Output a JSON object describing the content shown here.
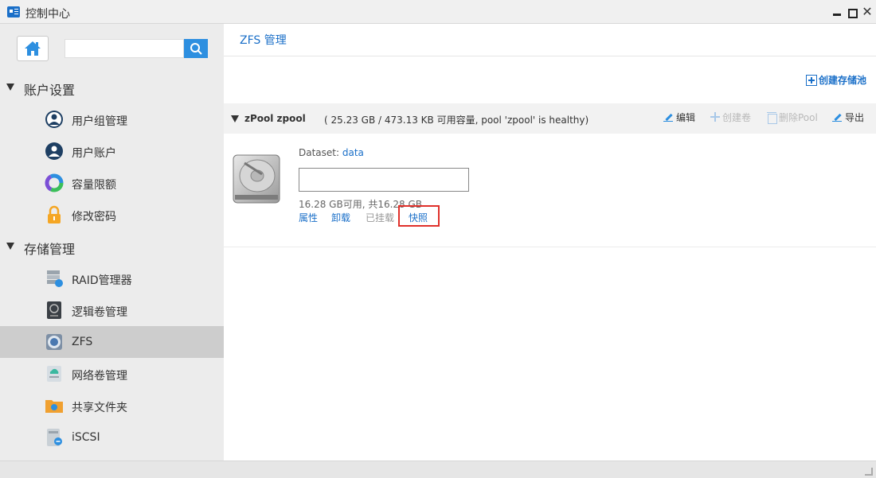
{
  "window": {
    "title": "控制中心",
    "close_glyph": "✕"
  },
  "sidebar": {
    "search": {
      "value": "",
      "placeholder": ""
    },
    "sections": [
      {
        "label": "账户设置",
        "items": [
          {
            "label": "用户组管理",
            "icon": "user-group-icon"
          },
          {
            "label": "用户账户",
            "icon": "user-account-icon"
          },
          {
            "label": "容量限额",
            "icon": "quota-ring-icon"
          },
          {
            "label": "修改密码",
            "icon": "lock-icon"
          }
        ]
      },
      {
        "label": "存储管理",
        "items": [
          {
            "label": "RAID管理器",
            "icon": "raid-icon"
          },
          {
            "label": "逻辑卷管理",
            "icon": "lvm-icon"
          },
          {
            "label": "ZFS",
            "icon": "zfs-icon",
            "active": true
          },
          {
            "label": "网络卷管理",
            "icon": "network-volume-icon"
          },
          {
            "label": "共享文件夹",
            "icon": "shared-folder-icon"
          },
          {
            "label": "iSCSI",
            "icon": "iscsi-icon"
          }
        ]
      }
    ]
  },
  "main": {
    "page_title": "ZFS 管理",
    "create_pool_label": "创建存储池",
    "pool": {
      "title": "zPool zpool",
      "info": "( 25.23 GB / 473.13 KB 可用容量, pool 'zpool' is healthy)",
      "actions": {
        "edit": "编辑",
        "create_volume": "创建卷",
        "delete_pool": "删除Pool",
        "export": "导出"
      }
    },
    "dataset": {
      "label": "Dataset:",
      "name": "data",
      "usage_text": "16.28 GB可用, 共16.28 GB",
      "used_fraction": 0,
      "actions": {
        "properties": "属性",
        "unmount": "卸载",
        "mounted": "已挂载",
        "snapshot": "快照"
      }
    }
  },
  "colors": {
    "accent": "#1a6fc8",
    "search_button": "#2d8fe0",
    "highlight_box": "#e0302a",
    "active_item_bg": "#cdcdcd"
  }
}
